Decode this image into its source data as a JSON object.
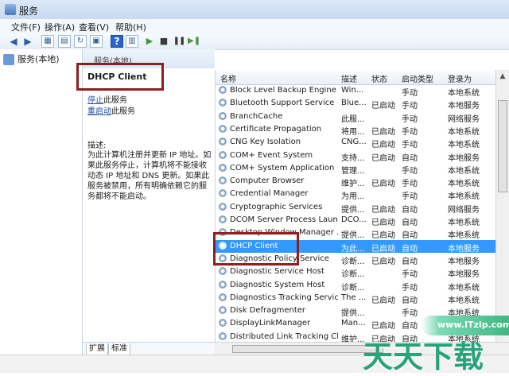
{
  "window": {
    "title": "服务"
  },
  "menu": [
    "文件(F)",
    "操作(A)",
    "查看(V)",
    "帮助(H)"
  ],
  "toolbar": {
    "icons": [
      "arrow-left-icon",
      "arrow-right-icon",
      "console-tree-icon",
      "export-list-icon",
      "refresh-icon",
      "properties-icon",
      "help-icon",
      "console-icon",
      "start-icon",
      "stop-icon",
      "pause-icon",
      "restart-icon"
    ]
  },
  "tree": {
    "item": "服务(本地)"
  },
  "detail": {
    "header": "服务(本地)",
    "service_name": "DHCP Client",
    "action_stop_link": "停止",
    "action_stop_text": "此服务",
    "action_restart_link": "重启动",
    "action_restart_text": "此服务",
    "desc_label": "描述:",
    "desc_text": "为此计算机注册并更新 IP 地址。如果此服务停止，计算机将不能接收动态 IP 地址和 DNS 更新。如果此服务被禁用，所有明确依赖它的服务都将不能启动。"
  },
  "list": {
    "headers": [
      "名称",
      "描述",
      "状态",
      "启动类型",
      "登录为"
    ],
    "rows": [
      [
        "Block Level Backup Engine ...",
        "Win...",
        "",
        "手动",
        "本地系统"
      ],
      [
        "Bluetooth Support Service",
        "Blue...",
        "已启动",
        "手动",
        "本地服务"
      ],
      [
        "BranchCache",
        "此服...",
        "",
        "手动",
        "网络服务"
      ],
      [
        "Certificate Propagation",
        "将用...",
        "已启动",
        "手动",
        "本地系统"
      ],
      [
        "CNG Key Isolation",
        "CNG...",
        "已启动",
        "手动",
        "本地系统"
      ],
      [
        "COM+ Event System",
        "支持...",
        "已启动",
        "自动",
        "本地服务"
      ],
      [
        "COM+ System Application",
        "管理...",
        "",
        "手动",
        "本地系统"
      ],
      [
        "Computer Browser",
        "维护...",
        "已启动",
        "手动",
        "本地系统"
      ],
      [
        "Credential Manager",
        "为用...",
        "",
        "手动",
        "本地系统"
      ],
      [
        "Cryptographic Services",
        "提供...",
        "已启动",
        "自动",
        "网络服务"
      ],
      [
        "DCOM Server Process Laun...",
        "DCO...",
        "已启动",
        "自动",
        "本地系统"
      ],
      [
        "Desktop Window Manager ...",
        "提供...",
        "已启动",
        "自动",
        "本地系统"
      ],
      [
        "DHCP Client",
        "为此...",
        "已启动",
        "自动",
        "本地服务"
      ],
      [
        "Diagnostic Policy Service",
        "诊断...",
        "已启动",
        "自动",
        "本地服务"
      ],
      [
        "Diagnostic Service Host",
        "诊断...",
        "",
        "手动",
        "本地服务"
      ],
      [
        "Diagnostic System Host",
        "诊断...",
        "",
        "手动",
        "本地系统"
      ],
      [
        "Diagnostics Tracking Service",
        "The ...",
        "已启动",
        "自动",
        "本地系统"
      ],
      [
        "Disk Defragmenter",
        "提供...",
        "",
        "手动",
        "本地系统"
      ],
      [
        "DisplayLinkManager",
        "Man...",
        "已启动",
        "自动",
        "本地系统"
      ],
      [
        "Distributed Link Tracking Cl...",
        "维护...",
        "已启动",
        "自动",
        "本地系统"
      ]
    ],
    "selected_row": 12
  },
  "tabs": [
    "扩展",
    "标准"
  ],
  "watermark": {
    "banner": "www.ITzip.com",
    "text": "天天下载"
  }
}
